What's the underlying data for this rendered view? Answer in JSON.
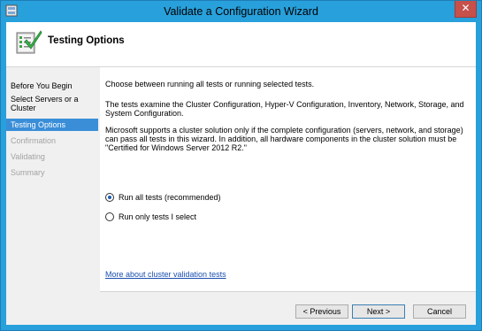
{
  "window": {
    "title": "Validate a Configuration Wizard",
    "close_glyph": "✕"
  },
  "header": {
    "title": "Testing Options",
    "icon": "wizard-checklist-icon"
  },
  "nav": {
    "items": [
      {
        "label": "Before You Begin",
        "state": "normal"
      },
      {
        "label": "Select Servers or a Cluster",
        "state": "normal"
      },
      {
        "label": "Testing Options",
        "state": "current"
      },
      {
        "label": "Confirmation",
        "state": "disabled"
      },
      {
        "label": "Validating",
        "state": "disabled"
      },
      {
        "label": "Summary",
        "state": "disabled"
      }
    ]
  },
  "content": {
    "intro": "Choose between running all tests or running selected tests.",
    "description": "The tests examine the Cluster Configuration, Hyper-V Configuration, Inventory, Network, Storage, and System Configuration.",
    "support_note": "Microsoft supports a cluster solution only if the complete configuration (servers, network, and storage) can pass all tests in this wizard. In addition, all hardware components in the cluster solution must be \"Certified for Windows Server 2012 R2.\"",
    "options": [
      {
        "label": "Run all tests (recommended)",
        "checked": true
      },
      {
        "label": "Run only tests I select",
        "checked": false
      }
    ],
    "link": "More about cluster validation tests"
  },
  "buttons": {
    "previous": "< Previous",
    "next": "Next >",
    "cancel": "Cancel"
  },
  "colors": {
    "title_bar": "#28a0db",
    "close_button": "#c7504b",
    "nav_selected": "#3a8ed8",
    "link": "#1a4fb0"
  }
}
